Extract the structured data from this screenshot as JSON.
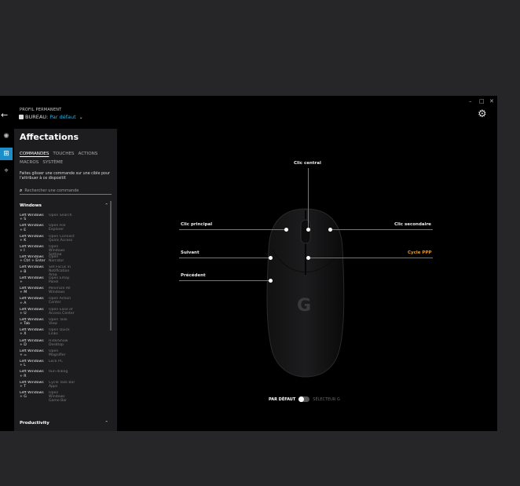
{
  "profile": {
    "label": "PROFIL PERMANENT",
    "name": "BUREAU:",
    "value": "Par défaut"
  },
  "window_controls": [
    "–",
    "□",
    "✕"
  ],
  "icons": {
    "back": "arrow-left-icon",
    "settings": "gear-icon",
    "lighting": "sun-icon",
    "assignments": "plus-square-icon",
    "dpi": "crosshair-icon",
    "search": "search-icon"
  },
  "panel": {
    "title": "Affectations",
    "tabs_row1": [
      "COMMANDES",
      "TOUCHES",
      "ACTIONS"
    ],
    "tabs_row2": [
      "MACROS",
      "SYSTÈME"
    ],
    "hint": "Faites glisser une commande sur une cible pour l'attribuer à ce dispositif.",
    "search_placeholder": "Rechercher une commande",
    "group1": "Windows",
    "group2": "Productivity",
    "rows": [
      {
        "key": "Left Windows\n+ S",
        "action": "Open Search"
      },
      {
        "key": "Left Windows\n+ E",
        "action": "Open File\nExplorer"
      },
      {
        "key": "Left Windows\n+ K",
        "action": "Open Connect\nQuick Access"
      },
      {
        "key": "Left Windows\n+ I",
        "action": "Open\nWindows\nSetting"
      },
      {
        "key": "Left Windows\n+ Ctrl + Enter",
        "action": "Open\nNarrator"
      },
      {
        "key": "Left Windows\n+ B",
        "action": "Set Focus in\nNotification\nArea"
      },
      {
        "key": "Left Windows\n+",
        "action": "Open Emoji\nPanel"
      },
      {
        "key": "Left Windows\n+ M",
        "action": "Minimize All\nWindows"
      },
      {
        "key": "Left Windows\n+ A",
        "action": "Open Action\nCenter"
      },
      {
        "key": "Left Windows\n+ U",
        "action": "Open Ease of\nAccess Center"
      },
      {
        "key": "Left Windows\n+ Tab",
        "action": "Open Task\nView"
      },
      {
        "key": "Left Windows\n+ X",
        "action": "Open Quick\nLinks"
      },
      {
        "key": "Left Windows\n+ D",
        "action": "Hide/Show\nDesktop"
      },
      {
        "key": "Left Windows\n+ =",
        "action": "Open\nMagnifier"
      },
      {
        "key": "Left Windows\n+ L",
        "action": "Lock PC"
      },
      {
        "key": "Left Windows\n+ R",
        "action": "Run dialog"
      },
      {
        "key": "Left Windows\n+ T",
        "action": "Cycle Task Bar\nApps"
      },
      {
        "key": "Left Windows\n+ G",
        "action": "Open\nWindows\nGame Bar"
      }
    ]
  },
  "mouse": {
    "clic_central": "Clic central",
    "clic_principal": "Clic principal",
    "clic_secondaire": "Clic secondaire",
    "suivant": "Suivant",
    "cycle_ppp": "Cycle PPP",
    "precedent": "Précédent",
    "accent_color": "#e09a2b"
  },
  "footer": {
    "on_label": "PAR DÉFAUT",
    "off_label": "SÉLECTEUR G"
  }
}
